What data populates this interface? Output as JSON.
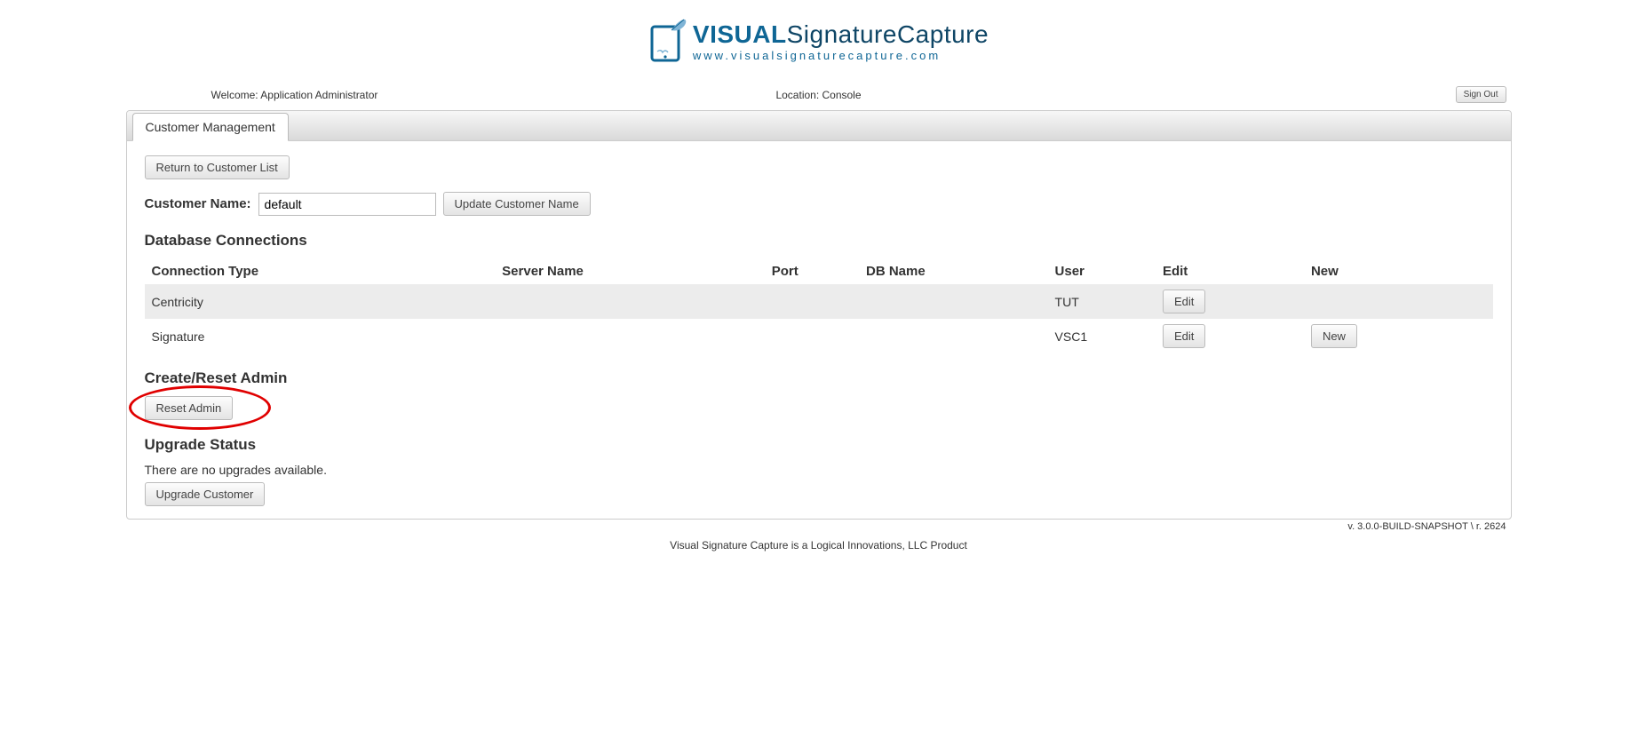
{
  "logo": {
    "main_bold": "VISUAL",
    "main_rest": "SignatureCapture",
    "sub": "www.visualsignaturecapture.com"
  },
  "header": {
    "welcome": "Welcome: Application Administrator",
    "location": "Location: Console",
    "signout": "Sign Out"
  },
  "tabs": {
    "customer_mgmt": "Customer Management"
  },
  "buttons": {
    "return_list": "Return to Customer List",
    "update_name": "Update Customer Name",
    "reset_admin": "Reset Admin",
    "upgrade_customer": "Upgrade Customer",
    "edit": "Edit",
    "new": "New"
  },
  "labels": {
    "customer_name": "Customer Name:",
    "db_connections": "Database Connections",
    "create_reset": "Create/Reset Admin",
    "upgrade_status": "Upgrade Status"
  },
  "inputs": {
    "customer_name_value": "default"
  },
  "table": {
    "headers": {
      "conn_type": "Connection Type",
      "server": "Server Name",
      "port": "Port",
      "dbname": "DB Name",
      "user": "User",
      "edit": "Edit",
      "new": "New"
    },
    "rows": [
      {
        "type": "Centricity",
        "server": "",
        "port": "",
        "dbname": "",
        "user": "TUT",
        "has_edit": true,
        "has_new": false
      },
      {
        "type": "Signature",
        "server": "",
        "port": "",
        "dbname": "",
        "user": "VSC1",
        "has_edit": true,
        "has_new": true
      }
    ]
  },
  "upgrade_msg": "There are no upgrades available.",
  "version": "v. 3.0.0-BUILD-SNAPSHOT \\ r. 2624",
  "footer": "Visual Signature Capture is a Logical Innovations, LLC Product"
}
